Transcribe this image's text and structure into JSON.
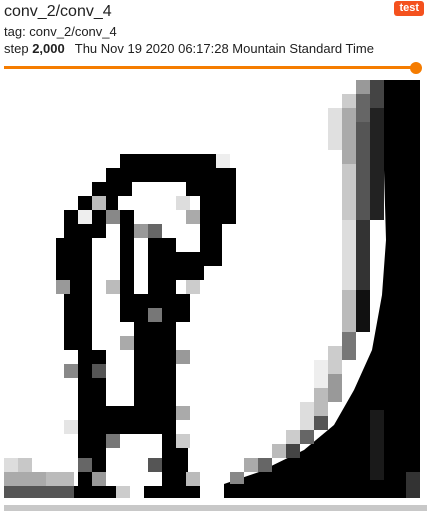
{
  "header": {
    "title": "conv_2/conv_4",
    "run_badge": "test",
    "tag_label": "tag: conv_2/conv_4",
    "step_prefix": "step",
    "step_value": "2,000",
    "timestamp": "Thu Nov 19 2020 06:17:28 Mountain Standard Time"
  },
  "slider": {
    "value_fraction": 1.0
  },
  "colors": {
    "accent": "#f57c00",
    "badge": "#f4511e"
  }
}
